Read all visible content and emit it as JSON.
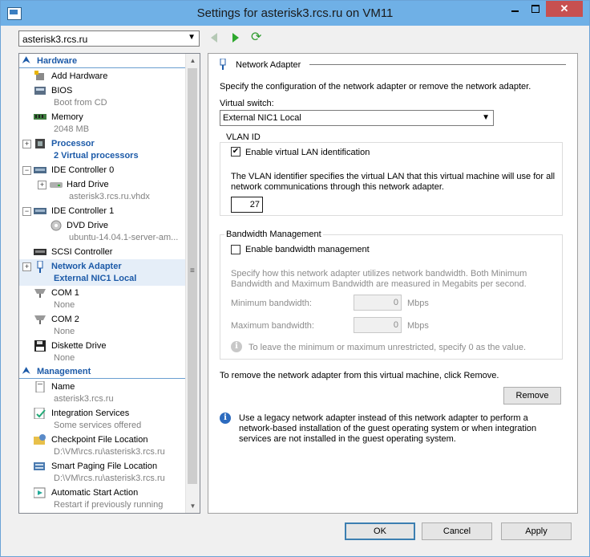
{
  "window": {
    "title": "Settings for asterisk3.rcs.ru on VM11"
  },
  "toolbar": {
    "vm_selected": "asterisk3.rcs.ru"
  },
  "tree": {
    "hardware_header": "Hardware",
    "management_header": "Management",
    "items": [
      {
        "name": "Add Hardware",
        "sub": ""
      },
      {
        "name": "BIOS",
        "sub": "Boot from CD"
      },
      {
        "name": "Memory",
        "sub": "2048 MB"
      },
      {
        "name": "Processor",
        "sub": "2 Virtual processors"
      },
      {
        "name": "IDE Controller 0",
        "sub": ""
      },
      {
        "name": "Hard Drive",
        "sub": "asterisk3.rcs.ru.vhdx"
      },
      {
        "name": "IDE Controller 1",
        "sub": ""
      },
      {
        "name": "DVD Drive",
        "sub": "ubuntu-14.04.1-server-am..."
      },
      {
        "name": "SCSI Controller",
        "sub": ""
      },
      {
        "name": "Network Adapter",
        "sub": "External NIC1 Local"
      },
      {
        "name": "COM 1",
        "sub": "None"
      },
      {
        "name": "COM 2",
        "sub": "None"
      },
      {
        "name": "Diskette Drive",
        "sub": "None"
      }
    ],
    "mgmt_items": [
      {
        "name": "Name",
        "sub": "asterisk3.rcs.ru"
      },
      {
        "name": "Integration Services",
        "sub": "Some services offered"
      },
      {
        "name": "Checkpoint File Location",
        "sub": "D:\\VM\\rcs.ru\\asterisk3.rcs.ru"
      },
      {
        "name": "Smart Paging File Location",
        "sub": "D:\\VM\\rcs.ru\\asterisk3.rcs.ru"
      },
      {
        "name": "Automatic Start Action",
        "sub": "Restart if previously running"
      }
    ]
  },
  "panel": {
    "title": "Network Adapter",
    "description": "Specify the configuration of the network adapter or remove the network adapter.",
    "virtual_switch_label": "Virtual switch:",
    "virtual_switch_value": "External NIC1 Local",
    "vlan_group": "VLAN ID",
    "vlan_enable_label": "Enable virtual LAN identification",
    "vlan_enabled": true,
    "vlan_desc1": "The VLAN identifier specifies the virtual LAN that this virtual machine will use for all",
    "vlan_desc2": "network communications through this network adapter.",
    "vlan_value": "27",
    "bw_group": "Bandwidth Management",
    "bw_enable_label": "Enable bandwidth management",
    "bw_enabled": false,
    "bw_desc1": "Specify how this network adapter utilizes network bandwidth. Both Minimum",
    "bw_desc2": "Bandwidth and Maximum Bandwidth are measured in Megabits per second.",
    "min_bw_label": "Minimum bandwidth:",
    "min_bw_value": "0",
    "max_bw_label": "Maximum bandwidth:",
    "max_bw_value": "0",
    "unit": "Mbps",
    "bw_note": "To leave the minimum or maximum unrestricted, specify 0 as the value.",
    "remove_text": "To remove the network adapter from this virtual machine, click Remove.",
    "remove_button": "Remove",
    "legacy1": "Use a legacy network adapter instead of this network adapter to perform a",
    "legacy2": "network-based installation of the guest operating system or when integration",
    "legacy3": "services are not installed in the guest operating system."
  },
  "footer": {
    "ok": "OK",
    "cancel": "Cancel",
    "apply": "Apply"
  },
  "colors": {
    "accent": "#1c5aa8",
    "titlebar": "#6fb0e6",
    "close": "#c75050",
    "selection": "#e5eef8"
  }
}
